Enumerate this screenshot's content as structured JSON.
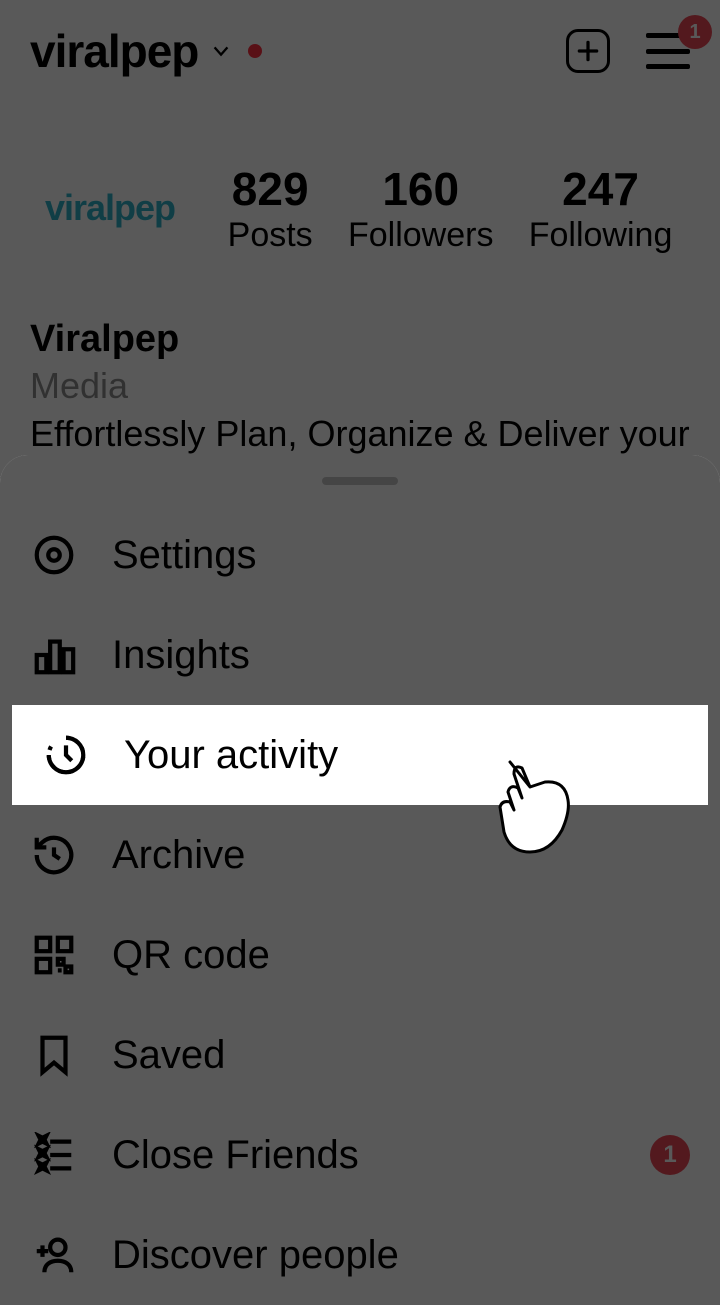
{
  "header": {
    "username": "viralpep",
    "menu_badge": "1"
  },
  "stats": {
    "posts": {
      "count": "829",
      "label": "Posts"
    },
    "followers": {
      "count": "160",
      "label": "Followers"
    },
    "following": {
      "count": "247",
      "label": "Following"
    }
  },
  "avatar_text": "viralpep",
  "bio": {
    "display_name": "Viralpep",
    "category": "Media",
    "description": "Effortlessly Plan, Organize & Deliver your social media content to multiple or single"
  },
  "menu": {
    "settings": "Settings",
    "insights": "Insights",
    "your_activity": "Your activity",
    "archive": "Archive",
    "qr_code": "QR code",
    "saved": "Saved",
    "close_friends": "Close Friends",
    "discover_people": "Discover people",
    "close_friends_badge": "1"
  }
}
